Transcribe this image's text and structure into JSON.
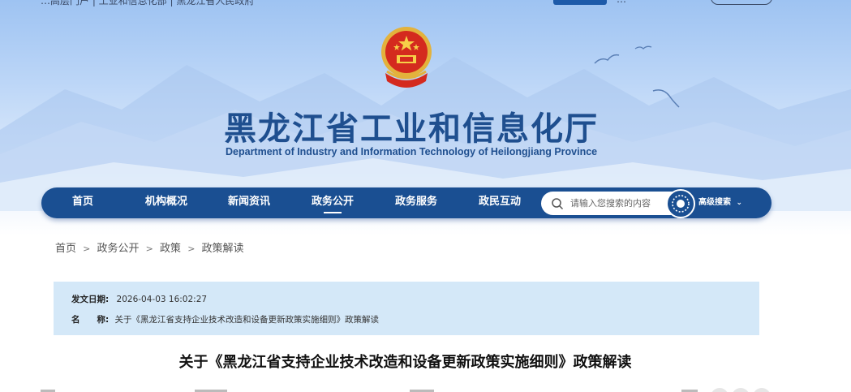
{
  "topbar": {
    "left_text": "…高层门户 | 工业和信息化部 | 黑龙江省人民政府",
    "middle_text": "…"
  },
  "site": {
    "title": "黑龙江省工业和信息化厅",
    "subtitle": "Department of Industry and Information Technology of Heilongjiang Province"
  },
  "nav": {
    "items": [
      {
        "label": "首页",
        "active": false
      },
      {
        "label": "机构概况",
        "active": false
      },
      {
        "label": "新闻资讯",
        "active": false
      },
      {
        "label": "政务公开",
        "active": true
      },
      {
        "label": "政务服务",
        "active": false
      },
      {
        "label": "政民互动",
        "active": false
      }
    ],
    "search_placeholder": "请输入您搜索的内容",
    "advanced_search": "高级搜索"
  },
  "breadcrumb": [
    "首页",
    "政务公开",
    "政策",
    "政策解读"
  ],
  "info": {
    "date_label": "发文日期:",
    "date_value": "2026-04-03 16:02:27",
    "name_label": "名　　称:",
    "name_value": "关于《黑龙江省支持企业技术改造和设备更新政策实施细则》政策解读"
  },
  "article": {
    "title": "关于《黑龙江省支持企业技术改造和设备更新政策实施细则》政策解读"
  },
  "colors": {
    "nav_bg": "#1a4f92",
    "title_blue": "#1f4f8f",
    "info_bg": "#d4e8f8"
  },
  "icons": [
    "national-emblem",
    "search-icon",
    "search-globe-icon",
    "chevron-down-icon",
    "bird-icon"
  ]
}
